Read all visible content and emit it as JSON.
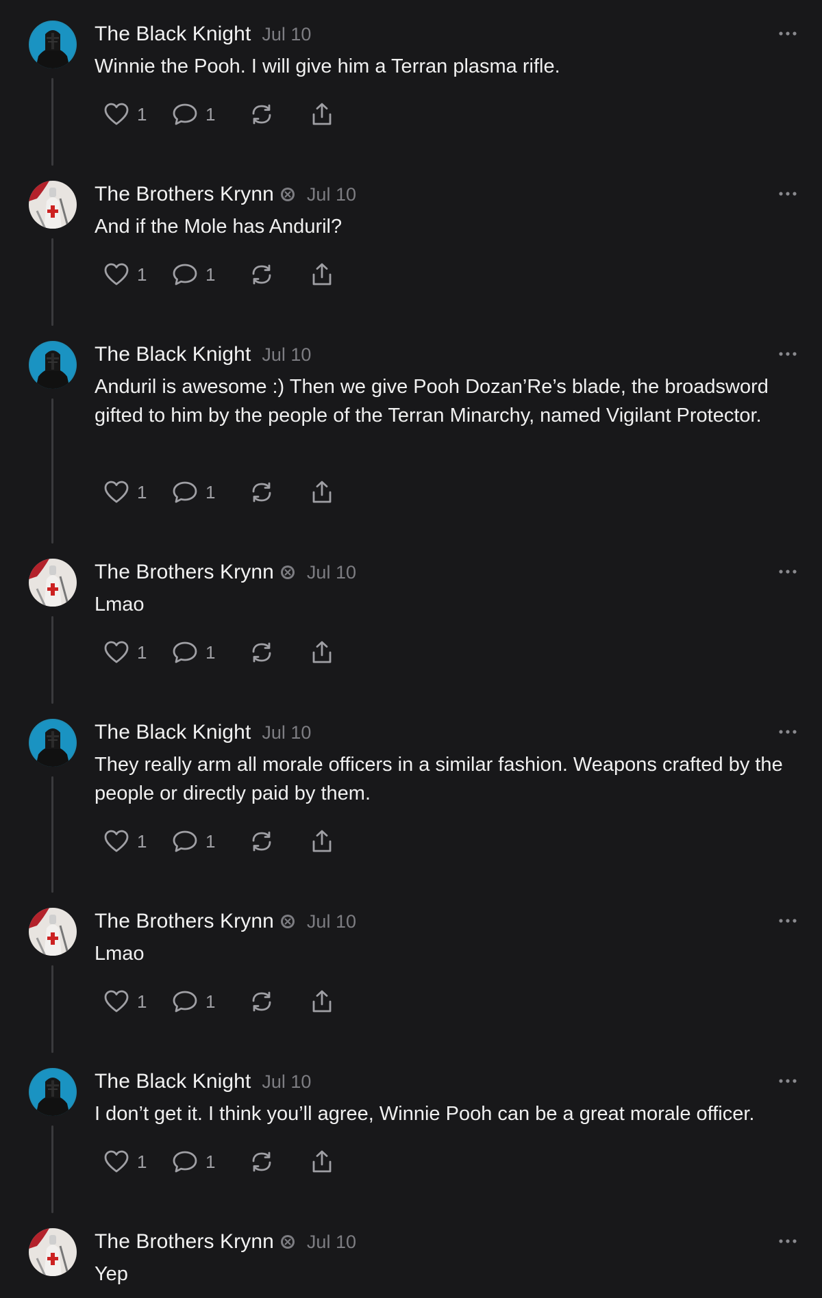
{
  "posts": [
    {
      "author": "The Black Knight",
      "avatar": "black-knight",
      "badge": false,
      "date": "Jul 10",
      "text": "Winnie the Pooh. I will give him a Terran plasma rifle.",
      "likes": "1",
      "replies": "1"
    },
    {
      "author": "The Brothers Krynn",
      "avatar": "brothers-krynn",
      "badge": true,
      "date": "Jul 10",
      "text": "And if the Mole has Anduril?",
      "likes": "1",
      "replies": "1"
    },
    {
      "author": "The Black Knight",
      "avatar": "black-knight",
      "badge": false,
      "date": "Jul 10",
      "text": "Anduril is awesome :) Then we give Pooh Dozan’Re’s blade, the broadsword gifted to him by the people of the Terran Minarchy, named Vigilant Protector.",
      "likes": "1",
      "replies": "1"
    },
    {
      "author": "The Brothers Krynn",
      "avatar": "brothers-krynn",
      "badge": true,
      "date": "Jul 10",
      "text": "Lmao",
      "likes": "1",
      "replies": "1"
    },
    {
      "author": "The Black Knight",
      "avatar": "black-knight",
      "badge": false,
      "date": "Jul 10",
      "text": "They really arm all morale officers in a similar fashion. Weapons crafted by the people or directly paid by them.",
      "likes": "1",
      "replies": "1"
    },
    {
      "author": "The Brothers Krynn",
      "avatar": "brothers-krynn",
      "badge": true,
      "date": "Jul 10",
      "text": "Lmao",
      "likes": "1",
      "replies": "1"
    },
    {
      "author": "The Black Knight",
      "avatar": "black-knight",
      "badge": false,
      "date": "Jul 10",
      "text": "I don’t get it. I think you’ll agree, Winnie Pooh can be a great morale officer.",
      "likes": "1",
      "replies": "1"
    },
    {
      "author": "The Brothers Krynn",
      "avatar": "brothers-krynn",
      "badge": true,
      "date": "Jul 10",
      "text": "Yep"
    }
  ],
  "icons": {
    "like": "heart-icon",
    "reply": "comment-icon",
    "repost": "repost-icon",
    "share": "share-icon",
    "more": "more-options-icon",
    "badge": "verified-badge-icon"
  },
  "colors": {
    "background": "#18181a",
    "text": "#f3f3f3",
    "muted": "#7d7d82",
    "icon": "#a0a0a5",
    "thread_line": "#3a3a3d"
  }
}
